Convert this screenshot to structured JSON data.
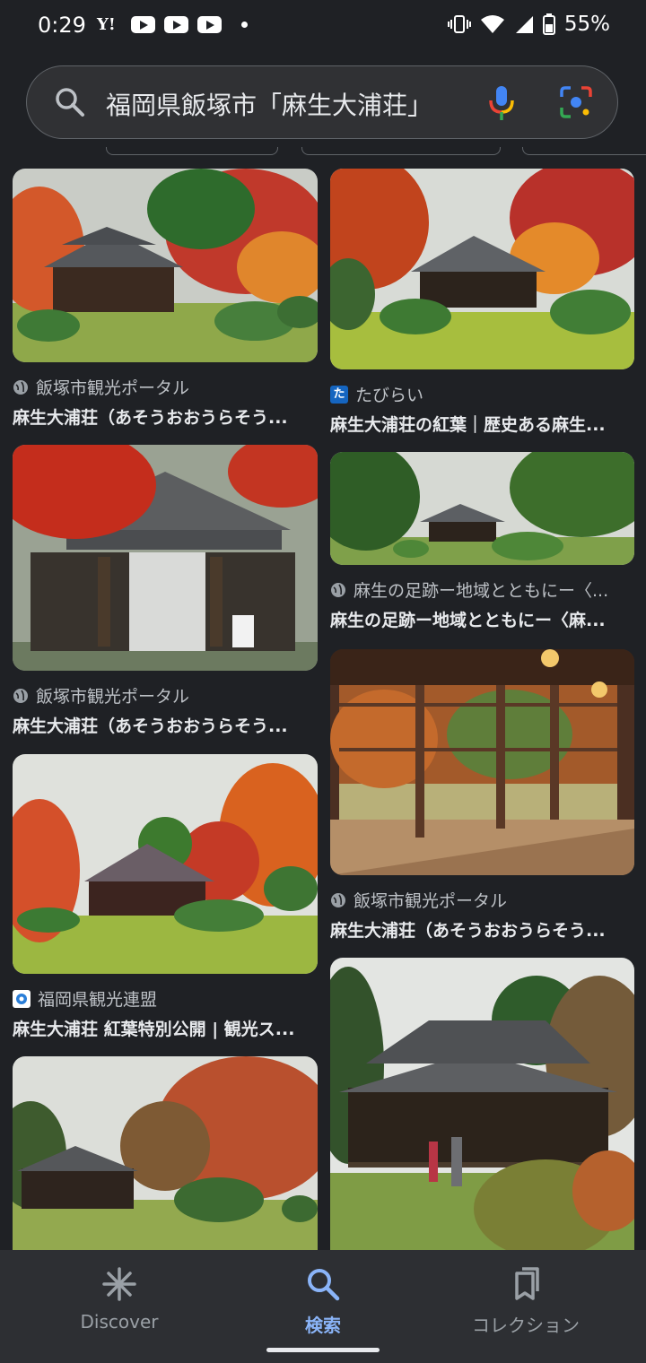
{
  "status_bar": {
    "time": "0:29",
    "yahoo_glyph": "Y!",
    "battery": "55%"
  },
  "search": {
    "query": "福岡県飯塚市「麻生大浦荘」",
    "icons": [
      "search-icon",
      "mic-icon",
      "lens-icon"
    ]
  },
  "results": [
    {
      "source": "飯塚市観光ポータル",
      "title": "麻生大浦荘（あそうおおうらそう..."
    },
    {
      "source": "たびらい",
      "title": "麻生大浦荘の紅葉｜歴史ある麻生..."
    },
    {
      "source": "飯塚市観光ポータル",
      "title": "麻生大浦荘（あそうおおうらそう..."
    },
    {
      "source": "麻生の足跡ー地域とともにー〈...",
      "title": "麻生の足跡ー地域とともにー〈麻..."
    },
    {
      "source": "福岡県観光連盟",
      "title": "麻生大浦荘 紅葉特別公開 | 観光ス..."
    },
    {
      "source": "飯塚市観光ポータル",
      "title": "麻生大浦荘（あそうおおうらそう..."
    }
  ],
  "nav": {
    "discover": "Discover",
    "search": "検索",
    "collections": "コレクション"
  },
  "colors": {
    "background": "#1f2125",
    "accent": "#8ab4f8"
  }
}
